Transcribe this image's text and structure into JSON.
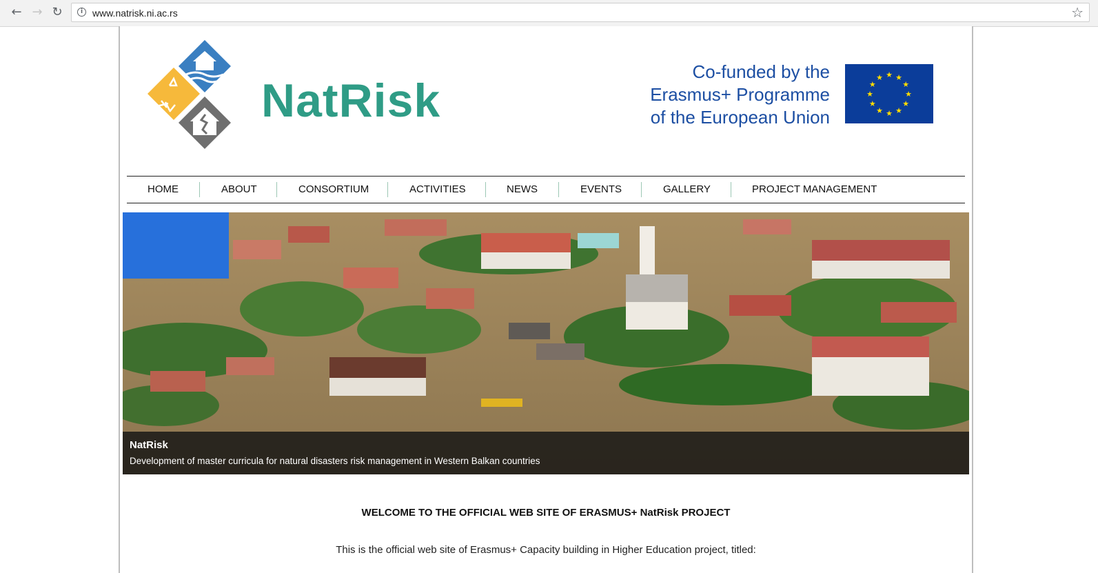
{
  "browser": {
    "back_icon": "arrow-left-icon",
    "forward_icon": "arrow-right-icon",
    "reload_icon": "reload-icon",
    "url": "www.natrisk.ni.ac.rs"
  },
  "header": {
    "logo_text": "NatRisk",
    "eu_lines": [
      "Co-funded by the",
      "Erasmus+ Programme",
      "of the European Union"
    ]
  },
  "menu": {
    "items": [
      "HOME",
      "ABOUT",
      "CONSORTIUM",
      "ACTIVITIES",
      "NEWS",
      "EVENTS",
      "GALLERY",
      "PROJECT MANAGEMENT"
    ]
  },
  "hero": {
    "caption_title": "NatRisk",
    "caption_text": "Development of master curricula for natural disasters risk management in Western Balkan countries"
  },
  "content": {
    "welcome": "WELCOME TO THE OFFICIAL WEB SITE OF ERASMUS+ NatRisk PROJECT",
    "intro": "This is the official web site of Erasmus+ Capacity building in Higher Education project, titled:"
  },
  "colors": {
    "brand_green": "#2f9c86",
    "eu_blue": "#1d4fa3",
    "eu_flag": "#0b3d9a",
    "eu_star": "#ffdd00",
    "logo_blue": "#3a7fc1",
    "logo_yellow": "#f6b93b",
    "logo_gray": "#6f6f6f"
  }
}
